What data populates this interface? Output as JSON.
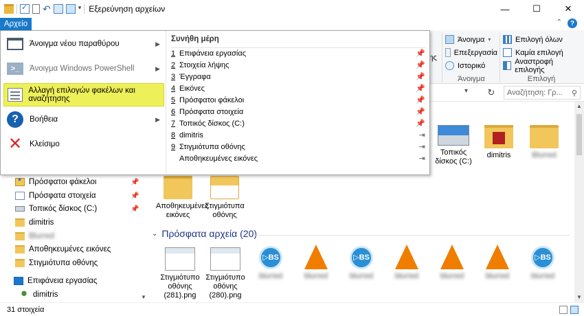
{
  "window": {
    "title": "Εξερεύνηση αρχείων",
    "controls": {
      "minimize": "—",
      "maximize": "☐",
      "close": "✕"
    }
  },
  "ribbon": {
    "file_tab": "Αρχείο",
    "help": "?",
    "partial_label": "της",
    "open_group": {
      "items": [
        "Άνοιγμα",
        "Επεξεργασία",
        "Ιστορικό"
      ],
      "caption": "Άνοιγμα"
    },
    "select_group": {
      "items": [
        "Επιλογή όλων",
        "Καμία επιλογή",
        "Αναστροφή επιλογής"
      ],
      "caption": "Επιλογή"
    }
  },
  "address": {
    "refresh": "↻",
    "search_placeholder": "Αναζήτηση: Γρ...",
    "search_icon": "search-icon"
  },
  "file_menu": {
    "items": [
      {
        "label": "Άνοιγμα νέου παραθύρου",
        "icon": "new-window-icon",
        "has_arrow": true,
        "disabled": false
      },
      {
        "label": "Άνοιγμα Windows PowerShell",
        "icon": "powershell-icon",
        "has_arrow": true,
        "disabled": true
      },
      {
        "label": "Αλλαγή επιλογών φακέλων και αναζήτησης",
        "icon": "folder-options-icon",
        "has_arrow": false,
        "highlighted": true
      },
      {
        "label": "Βοήθεια",
        "icon": "help-icon",
        "has_arrow": true,
        "disabled": false
      },
      {
        "label": "Κλείσιμο",
        "icon": "close-icon",
        "has_arrow": false,
        "disabled": false
      }
    ],
    "frequent_title": "Συνήθη μέρη",
    "frequent": [
      {
        "num": "1",
        "label": "Επιφάνεια εργασίας",
        "pinned": true
      },
      {
        "num": "2",
        "label": "Στοιχεία λήψης",
        "pinned": true
      },
      {
        "num": "3",
        "label": "Έγγραφα",
        "pinned": true
      },
      {
        "num": "4",
        "label": "Εικόνες",
        "pinned": true
      },
      {
        "num": "5",
        "label": "Πρόσφατοι φάκελοι",
        "pinned": true
      },
      {
        "num": "6",
        "label": "Πρόσφατα στοιχεία",
        "pinned": true
      },
      {
        "num": "7",
        "label": "Τοπικός δίσκος (C:)",
        "pinned": true
      },
      {
        "num": "8",
        "label": "dimitris",
        "pinned": false
      },
      {
        "num": "9",
        "label": "Στιγμιότυπα οθόνης",
        "pinned": false
      },
      {
        "num": "",
        "label": "Αποθηκευμένες εικόνες",
        "pinned": false
      }
    ]
  },
  "nav": {
    "items": [
      {
        "label": "Πρόσφατοι φάκελοι",
        "icon": "recent-folders-icon",
        "pinned": true
      },
      {
        "label": "Πρόσφατα στοιχεία",
        "icon": "recent-items-icon",
        "pinned": true
      },
      {
        "label": "Τοπικός δίσκος (C:)",
        "icon": "drive-icon",
        "pinned": true
      },
      {
        "label": "dimitris",
        "icon": "folder-icon",
        "pinned": false
      },
      {
        "label": "Blurred",
        "icon": "folder-icon",
        "pinned": false,
        "blurred": true
      },
      {
        "label": "Αποθηκευμένες εικόνες",
        "icon": "folder-icon",
        "pinned": false
      },
      {
        "label": "Στιγμιότυπα οθόνης",
        "icon": "folder-icon",
        "pinned": false
      },
      {
        "label": "Επιφάνεια εργασίας",
        "icon": "desktop-icon",
        "pinned": false
      },
      {
        "label": "dimitris",
        "icon": "user-icon",
        "pinned": false
      }
    ]
  },
  "content": {
    "top_tiles": [
      {
        "label": "Τοπικός δίσκος (C:)",
        "icon": "drive-icon"
      },
      {
        "label": "dimitris",
        "icon": "user-folder-icon"
      },
      {
        "label": "Blurred",
        "icon": "folder-icon",
        "blurred": true
      }
    ],
    "folder_tiles": [
      {
        "label": "Αποθηκευμένες εικόνες",
        "icon": "folder-icon"
      },
      {
        "label": "Στιγμιότυπα οθόνης",
        "icon": "screenshots-folder-icon"
      }
    ],
    "recent_header": "Πρόσφατα αρχεία (20)",
    "recent_files": [
      {
        "label": "Στιγμιότυπο οθόνης (281).png",
        "icon": "png-thumbnail-icon"
      },
      {
        "label": "Στιγμιότυπο οθόνης (280).png",
        "icon": "png-thumbnail-icon"
      },
      {
        "label": "blurred",
        "icon": "bs-player-icon",
        "blurred": true
      },
      {
        "label": "blurred",
        "icon": "vlc-icon",
        "blurred": true
      },
      {
        "label": "blurred",
        "icon": "bs-player-icon",
        "blurred": true
      },
      {
        "label": "blurred",
        "icon": "vlc-icon",
        "blurred": true
      },
      {
        "label": "blurred",
        "icon": "vlc-icon",
        "blurred": true
      },
      {
        "label": "blurred",
        "icon": "vlc-icon",
        "blurred": true
      },
      {
        "label": "blurred",
        "icon": "bs-player-icon",
        "blurred": true
      }
    ]
  },
  "status": {
    "count": "31 στοιχεία"
  }
}
